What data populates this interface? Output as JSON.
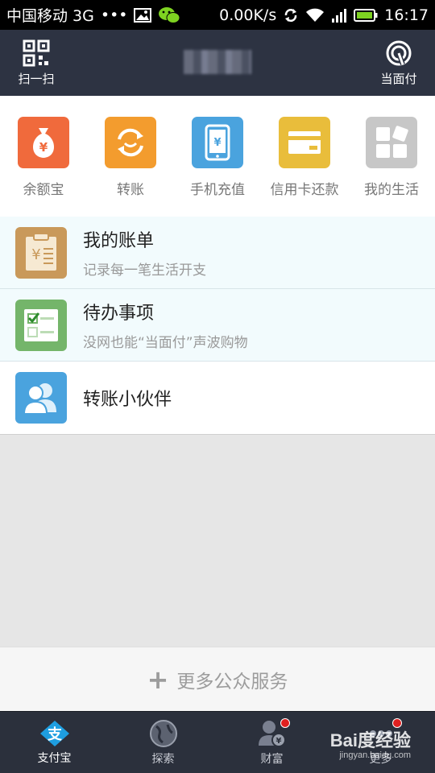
{
  "status_bar": {
    "carrier": "中国移动 3G",
    "dots": "•••",
    "speed": "0.00K/s",
    "time": "16:17"
  },
  "header": {
    "scan_label": "扫一扫",
    "pay_label": "当面付"
  },
  "quick_actions": [
    {
      "label": "余额宝",
      "icon": "money-bag-icon",
      "color": "#f06a3c"
    },
    {
      "label": "转账",
      "icon": "transfer-icon",
      "color": "#f39c2e"
    },
    {
      "label": "手机充值",
      "icon": "phone-recharge-icon",
      "color": "#4aa3de"
    },
    {
      "label": "信用卡还款",
      "icon": "credit-card-icon",
      "color": "#e9bd3b"
    },
    {
      "label": "我的生活",
      "icon": "apps-icon",
      "color": "#c7c7c7"
    }
  ],
  "list": [
    {
      "title": "我的账单",
      "subtitle": "记录每一笔生活开支",
      "icon": "bill-icon",
      "color": "#c9995a"
    },
    {
      "title": "待办事项",
      "subtitle": "没网也能“当面付”声波购物",
      "icon": "todo-icon",
      "color": "#74b56a"
    },
    {
      "title": "转账小伙伴",
      "subtitle": "",
      "icon": "contacts-icon",
      "color": "#4aa3de"
    }
  ],
  "more_services": {
    "plus": "+",
    "label": "更多公众服务"
  },
  "tabs": [
    {
      "label": "支付宝",
      "icon": "alipay-icon",
      "active": true
    },
    {
      "label": "探索",
      "icon": "globe-icon",
      "active": false
    },
    {
      "label": "财富",
      "icon": "wealth-icon",
      "active": false
    },
    {
      "label": "更多",
      "icon": "more-icon",
      "active": false
    }
  ],
  "watermark": {
    "text": "Bai度经验",
    "url": "jingyan.baidu.com"
  }
}
